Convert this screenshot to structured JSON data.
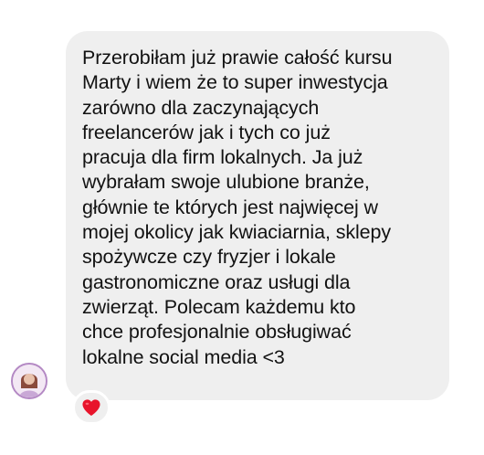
{
  "message": {
    "text": "Przerobiłam już prawie całość kursu\nMarty i wiem że to super inwestycja\nzarówno dla zaczynających\nfreelancerów jak i tych co już\npracuja dla firm lokalnych. Ja już\nwybrałam swoje ulubione branże,\ngłównie te których jest najwięcej w\nmojej okolicy jak kwiaciarnia, sklepy\nspożywcze czy fryzjer i lokale\ngastronomiczne oraz usługi dla\nzwierząt. Polecam każdemu kto\nchce profesjonalnie obsługiwać\nlokalne social media <3",
    "bubble_color": "#efefef",
    "text_color": "#121212"
  },
  "sender": {
    "avatar_icon": "profile-avatar",
    "avatar_ring_color": "#b489c4"
  },
  "reaction": {
    "icon": "red-heart-icon",
    "color": "#e8142b"
  }
}
